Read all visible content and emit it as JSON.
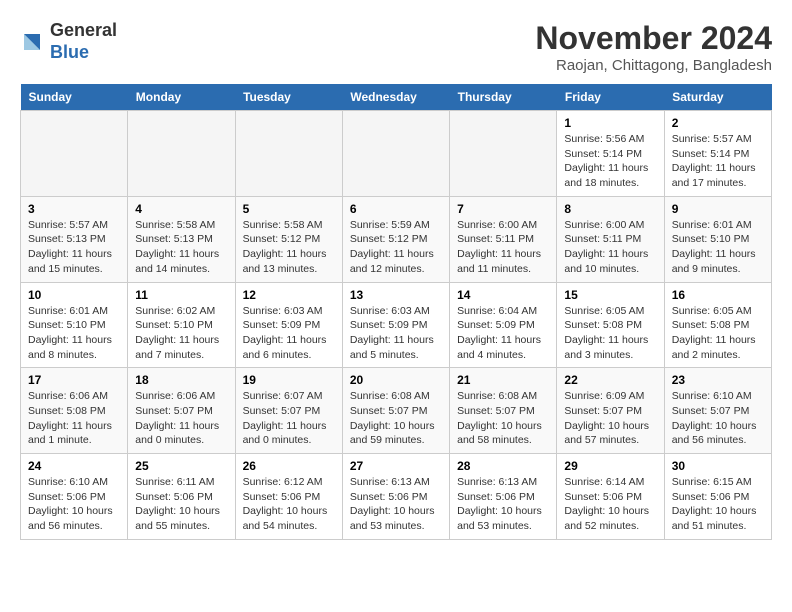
{
  "header": {
    "logo_line1": "General",
    "logo_line2": "Blue",
    "month": "November 2024",
    "location": "Raojan, Chittagong, Bangladesh"
  },
  "weekdays": [
    "Sunday",
    "Monday",
    "Tuesday",
    "Wednesday",
    "Thursday",
    "Friday",
    "Saturday"
  ],
  "weeks": [
    [
      {
        "day": "",
        "info": ""
      },
      {
        "day": "",
        "info": ""
      },
      {
        "day": "",
        "info": ""
      },
      {
        "day": "",
        "info": ""
      },
      {
        "day": "",
        "info": ""
      },
      {
        "day": "1",
        "info": "Sunrise: 5:56 AM\nSunset: 5:14 PM\nDaylight: 11 hours and 18 minutes."
      },
      {
        "day": "2",
        "info": "Sunrise: 5:57 AM\nSunset: 5:14 PM\nDaylight: 11 hours and 17 minutes."
      }
    ],
    [
      {
        "day": "3",
        "info": "Sunrise: 5:57 AM\nSunset: 5:13 PM\nDaylight: 11 hours and 15 minutes."
      },
      {
        "day": "4",
        "info": "Sunrise: 5:58 AM\nSunset: 5:13 PM\nDaylight: 11 hours and 14 minutes."
      },
      {
        "day": "5",
        "info": "Sunrise: 5:58 AM\nSunset: 5:12 PM\nDaylight: 11 hours and 13 minutes."
      },
      {
        "day": "6",
        "info": "Sunrise: 5:59 AM\nSunset: 5:12 PM\nDaylight: 11 hours and 12 minutes."
      },
      {
        "day": "7",
        "info": "Sunrise: 6:00 AM\nSunset: 5:11 PM\nDaylight: 11 hours and 11 minutes."
      },
      {
        "day": "8",
        "info": "Sunrise: 6:00 AM\nSunset: 5:11 PM\nDaylight: 11 hours and 10 minutes."
      },
      {
        "day": "9",
        "info": "Sunrise: 6:01 AM\nSunset: 5:10 PM\nDaylight: 11 hours and 9 minutes."
      }
    ],
    [
      {
        "day": "10",
        "info": "Sunrise: 6:01 AM\nSunset: 5:10 PM\nDaylight: 11 hours and 8 minutes."
      },
      {
        "day": "11",
        "info": "Sunrise: 6:02 AM\nSunset: 5:10 PM\nDaylight: 11 hours and 7 minutes."
      },
      {
        "day": "12",
        "info": "Sunrise: 6:03 AM\nSunset: 5:09 PM\nDaylight: 11 hours and 6 minutes."
      },
      {
        "day": "13",
        "info": "Sunrise: 6:03 AM\nSunset: 5:09 PM\nDaylight: 11 hours and 5 minutes."
      },
      {
        "day": "14",
        "info": "Sunrise: 6:04 AM\nSunset: 5:09 PM\nDaylight: 11 hours and 4 minutes."
      },
      {
        "day": "15",
        "info": "Sunrise: 6:05 AM\nSunset: 5:08 PM\nDaylight: 11 hours and 3 minutes."
      },
      {
        "day": "16",
        "info": "Sunrise: 6:05 AM\nSunset: 5:08 PM\nDaylight: 11 hours and 2 minutes."
      }
    ],
    [
      {
        "day": "17",
        "info": "Sunrise: 6:06 AM\nSunset: 5:08 PM\nDaylight: 11 hours and 1 minute."
      },
      {
        "day": "18",
        "info": "Sunrise: 6:06 AM\nSunset: 5:07 PM\nDaylight: 11 hours and 0 minutes."
      },
      {
        "day": "19",
        "info": "Sunrise: 6:07 AM\nSunset: 5:07 PM\nDaylight: 11 hours and 0 minutes."
      },
      {
        "day": "20",
        "info": "Sunrise: 6:08 AM\nSunset: 5:07 PM\nDaylight: 10 hours and 59 minutes."
      },
      {
        "day": "21",
        "info": "Sunrise: 6:08 AM\nSunset: 5:07 PM\nDaylight: 10 hours and 58 minutes."
      },
      {
        "day": "22",
        "info": "Sunrise: 6:09 AM\nSunset: 5:07 PM\nDaylight: 10 hours and 57 minutes."
      },
      {
        "day": "23",
        "info": "Sunrise: 6:10 AM\nSunset: 5:07 PM\nDaylight: 10 hours and 56 minutes."
      }
    ],
    [
      {
        "day": "24",
        "info": "Sunrise: 6:10 AM\nSunset: 5:06 PM\nDaylight: 10 hours and 56 minutes."
      },
      {
        "day": "25",
        "info": "Sunrise: 6:11 AM\nSunset: 5:06 PM\nDaylight: 10 hours and 55 minutes."
      },
      {
        "day": "26",
        "info": "Sunrise: 6:12 AM\nSunset: 5:06 PM\nDaylight: 10 hours and 54 minutes."
      },
      {
        "day": "27",
        "info": "Sunrise: 6:13 AM\nSunset: 5:06 PM\nDaylight: 10 hours and 53 minutes."
      },
      {
        "day": "28",
        "info": "Sunrise: 6:13 AM\nSunset: 5:06 PM\nDaylight: 10 hours and 53 minutes."
      },
      {
        "day": "29",
        "info": "Sunrise: 6:14 AM\nSunset: 5:06 PM\nDaylight: 10 hours and 52 minutes."
      },
      {
        "day": "30",
        "info": "Sunrise: 6:15 AM\nSunset: 5:06 PM\nDaylight: 10 hours and 51 minutes."
      }
    ]
  ]
}
